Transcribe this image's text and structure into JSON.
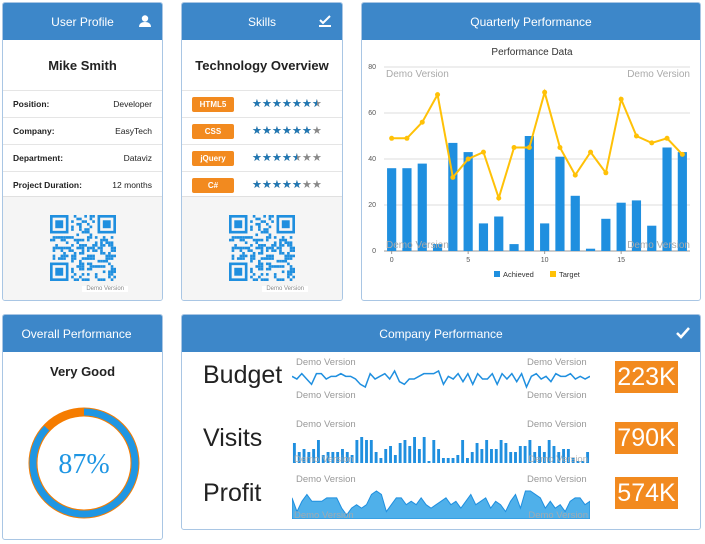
{
  "user_profile": {
    "header": "User Profile",
    "header_icon": "user-icon",
    "name": "Mike Smith",
    "fields": [
      {
        "label": "Position:",
        "value": "Developer"
      },
      {
        "label": "Company:",
        "value": "EasyTech"
      },
      {
        "label": "Department:",
        "value": "Dataviz"
      },
      {
        "label": "Project Duration:",
        "value": "12 months"
      }
    ],
    "qr_watermark": "Demo Version"
  },
  "skills": {
    "header": "Skills",
    "header_icon": "checkbox-icon",
    "title": "Technology Overview",
    "max_stars": 7,
    "items": [
      {
        "name": "HTML5",
        "rating": 6.5
      },
      {
        "name": "CSS",
        "rating": 6
      },
      {
        "name": "jQuery",
        "rating": 4.5
      },
      {
        "name": "C#",
        "rating": 5
      }
    ],
    "qr_watermark": "Demo Version"
  },
  "quarterly": {
    "header": "Quarterly Performance",
    "header_icon": "move-icon",
    "watermark": "Demo Version"
  },
  "chart_data": {
    "type": "bar",
    "title": "Performance Data",
    "xlabel": "",
    "ylabel": "",
    "x": [
      0,
      1,
      2,
      3,
      4,
      5,
      6,
      7,
      8,
      9,
      10,
      11,
      12,
      13,
      14,
      15,
      16,
      17,
      18,
      19
    ],
    "x_ticks": [
      "0",
      "5",
      "10",
      "15"
    ],
    "y_ticks": [
      "0",
      "20",
      "40",
      "60",
      "80"
    ],
    "ylim": [
      0,
      80
    ],
    "grid": true,
    "legend": "bottom",
    "series": [
      {
        "name": "Achieved",
        "type": "bar",
        "color": "#1f8fdf",
        "values": [
          36,
          36,
          38,
          3,
          47,
          43,
          12,
          15,
          3,
          50,
          12,
          41,
          24,
          1,
          14,
          21,
          22,
          11,
          45,
          43
        ]
      },
      {
        "name": "Target",
        "type": "line",
        "color": "#ffc107",
        "values": [
          49,
          49,
          56,
          68,
          32,
          40,
          43,
          23,
          45,
          45,
          69,
          45,
          33,
          43,
          34,
          66,
          50,
          47,
          49,
          42
        ]
      }
    ]
  },
  "overall": {
    "header": "Overall Performance",
    "header_icon": "search-icon",
    "rating": "Very Good",
    "percent_label": "87%",
    "percent": 87,
    "colors": {
      "fill": "#1f96e3",
      "rest": "#f57c00"
    }
  },
  "company": {
    "header": "Company Performance",
    "header_icon": "check-icon",
    "watermark": "Demo Version",
    "metrics": [
      {
        "label": "Budget",
        "value": "223K",
        "type": "line",
        "series": [
          5,
          4,
          6,
          4,
          2,
          6,
          6,
          4,
          5,
          5,
          6,
          5,
          5,
          4,
          2,
          1,
          6,
          4,
          5,
          6,
          4,
          7,
          3,
          2,
          4,
          4,
          5,
          6,
          6,
          6,
          7,
          2,
          5,
          4,
          6,
          3,
          6,
          2,
          6,
          4,
          4,
          6,
          2,
          6,
          4,
          6,
          3,
          6,
          1,
          5,
          6,
          4,
          5,
          3,
          6,
          5,
          5,
          6,
          4,
          5,
          4,
          5
        ]
      },
      {
        "label": "Visits",
        "value": "790K",
        "type": "bar",
        "series": [
          6,
          3,
          4,
          3,
          4,
          7,
          2,
          3,
          3,
          3,
          4,
          3,
          2,
          7,
          8,
          7,
          7,
          3,
          1,
          4,
          5,
          2,
          6,
          7,
          5,
          8,
          4,
          8,
          0,
          7,
          4,
          1,
          1,
          1,
          2,
          7,
          1,
          3,
          6,
          4,
          7,
          4,
          4,
          7,
          6,
          3,
          3,
          5,
          5,
          7,
          3,
          5,
          3,
          7,
          5,
          3,
          4,
          4,
          1,
          0,
          0,
          3
        ]
      },
      {
        "label": "Profit",
        "value": "574K",
        "type": "area",
        "series": [
          6,
          2,
          5,
          7,
          5,
          5,
          5,
          6,
          6,
          6,
          3,
          1,
          3,
          4,
          3,
          4,
          7,
          8,
          7,
          2,
          4,
          6,
          6,
          4,
          5,
          4,
          6,
          4,
          3,
          4,
          5,
          6,
          4,
          5,
          3,
          5,
          7,
          4,
          5,
          6,
          3,
          5,
          4,
          2,
          5,
          7,
          3,
          8,
          8,
          7,
          6,
          3,
          5,
          3,
          4,
          2,
          5,
          6,
          6,
          4,
          5
        ]
      }
    ]
  }
}
